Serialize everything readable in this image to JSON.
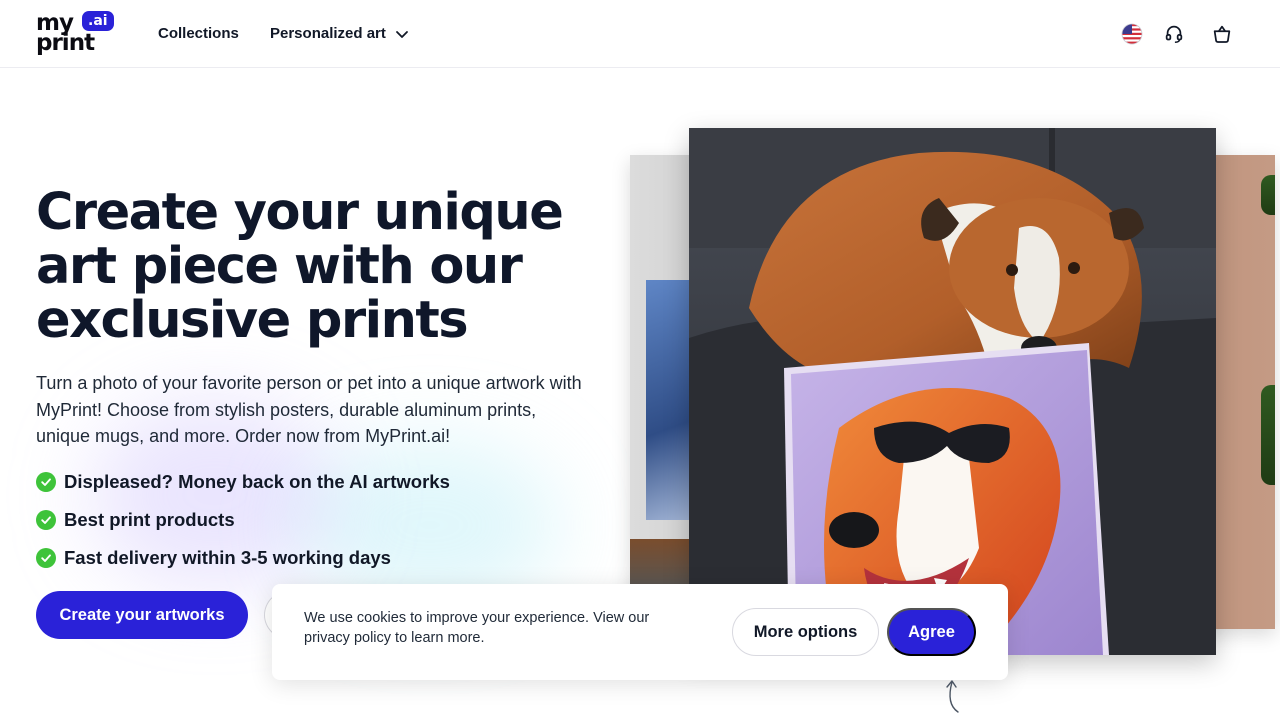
{
  "brand": {
    "logo_word1": "my",
    "logo_word2": "print",
    "logo_badge": ".ai",
    "accent": "#2a22d8",
    "check_color": "#3ec33a"
  },
  "nav": {
    "collections": "Collections",
    "personalized": "Personalized art",
    "icons": [
      "us-flag-icon",
      "headset-support-icon",
      "shopping-bag-icon"
    ]
  },
  "hero": {
    "headline": "Create your unique art piece with our exclusive prints",
    "subtext": "Turn a photo of your favorite person or pet into a unique artwork with MyPrint! Choose from stylish posters, durable aluminum prints, unique mugs, and more. Order now from MyPrint.ai!",
    "features": [
      "Displeased? Money back on the AI artworks",
      "Best print products",
      "Fast delivery within 3-5 working days"
    ],
    "cta_primary": "Create your artworks"
  },
  "cookie": {
    "text": "We use cookies to improve your experience. View our privacy policy to learn more.",
    "more_options": "More options",
    "agree": "Agree"
  }
}
